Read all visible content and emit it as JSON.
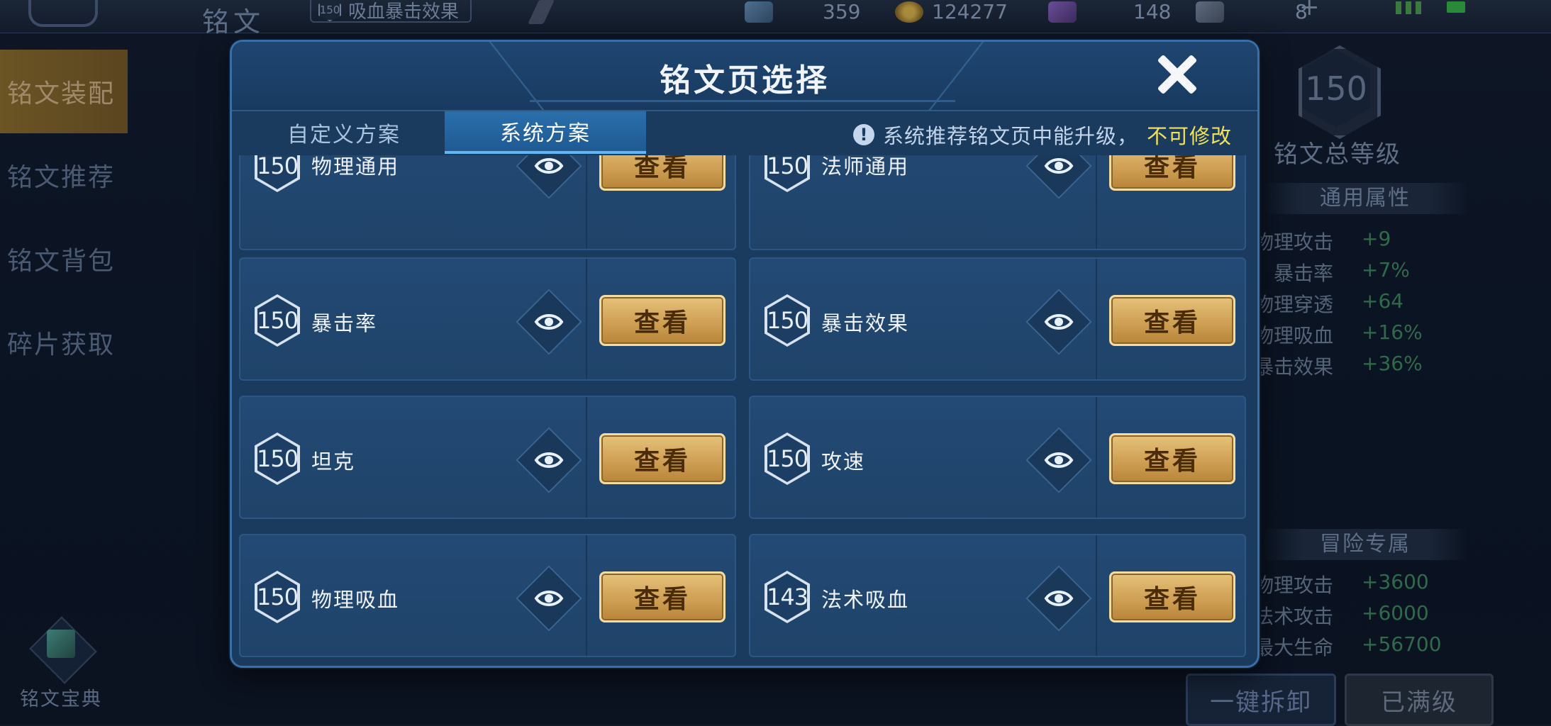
{
  "background": {
    "top_title": "铭文",
    "top_chip_level": "150",
    "top_chip_label": "吸血暴击效果",
    "resources": [
      "359",
      "124277",
      "148",
      "8"
    ],
    "sidenav": [
      "铭文装配",
      "铭文推荐",
      "铭文背包",
      "碎片获取"
    ],
    "library_label": "铭文宝典",
    "total_level": "150",
    "total_level_label": "铭文总等级",
    "general_header": "通用属性",
    "general_stats": [
      {
        "name": "物理攻击",
        "value": "+9"
      },
      {
        "name": "暴击率",
        "value": "+7%"
      },
      {
        "name": "物理穿透",
        "value": "+64"
      },
      {
        "name": "物理吸血",
        "value": "+16%"
      },
      {
        "name": "暴击效果",
        "value": "+36%"
      }
    ],
    "adventure_header": "冒险专属",
    "adventure_stats": [
      {
        "name": "物理攻击",
        "value": "+3600"
      },
      {
        "name": "法术攻击",
        "value": "+6000"
      },
      {
        "name": "最大生命",
        "value": "+56700"
      }
    ],
    "dismantle_label": "一键拆卸",
    "maxed_label": "已满级"
  },
  "modal": {
    "title": "铭文页选择",
    "tabs": [
      "自定义方案",
      "系统方案"
    ],
    "active_tab": 1,
    "notice_text": "系统推荐铭文页中能升级，",
    "notice_warn": "不可修改",
    "view_label": "查看",
    "pages": [
      {
        "level": "150",
        "name": "物理通用"
      },
      {
        "level": "150",
        "name": "法师通用"
      },
      {
        "level": "150",
        "name": "暴击率"
      },
      {
        "level": "150",
        "name": "暴击效果"
      },
      {
        "level": "150",
        "name": "坦克"
      },
      {
        "level": "150",
        "name": "攻速"
      },
      {
        "level": "150",
        "name": "物理吸血"
      },
      {
        "level": "143",
        "name": "法术吸血"
      }
    ]
  },
  "colors": {
    "accent": "#64b6f2",
    "gold": "#cfa055",
    "warn": "#f0e05a",
    "green_stat": "#2f6b4a"
  }
}
